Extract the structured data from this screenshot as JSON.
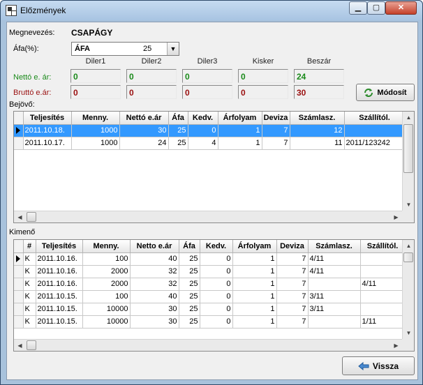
{
  "window": {
    "title": "Előzmények",
    "minimize": "▁",
    "maximize": "▢",
    "close": "✕"
  },
  "form": {
    "name_label": "Megnevezés:",
    "name_value": "CSAPÁGY",
    "afa_label": "Áfa(%):",
    "afa_select_name": "ÁFA",
    "afa_select_value": "25",
    "price_headers": [
      "Diler1",
      "Diler2",
      "Diler3",
      "Kisker",
      "Beszár"
    ],
    "netto_label": "Nettó e. ár:",
    "brutto_label": "Bruttó e.ár:",
    "netto_values": [
      "0",
      "0",
      "0",
      "0",
      "24"
    ],
    "brutto_values": [
      "0",
      "0",
      "0",
      "0",
      "30"
    ],
    "modify_button": "Módosít"
  },
  "incoming": {
    "label": "Bejövő:",
    "columns": [
      "Teljesítés",
      "Menny.",
      "Nettó e.ár",
      "Áfa",
      "Kedv.",
      "Árfolyam",
      "Deviza",
      "Számlasz.",
      "Szállítól."
    ],
    "rows": [
      [
        "2011.10.18.",
        "1000",
        "30",
        "25",
        "0",
        "1",
        "7",
        "12",
        ""
      ],
      [
        "2011.10.17.",
        "1000",
        "24",
        "25",
        "4",
        "1",
        "7",
        "11",
        "2011/123242"
      ]
    ]
  },
  "outgoing": {
    "label": "Kimenő",
    "columns": [
      "#",
      "Teljesítés",
      "Menny.",
      "Netto e.ár",
      "Áfa",
      "Kedv.",
      "Árfolyam",
      "Deviza",
      "Számlasz.",
      "Szállítól."
    ],
    "rows": [
      [
        "K",
        "2011.10.16.",
        "100",
        "40",
        "25",
        "0",
        "1",
        "7",
        "4/11",
        ""
      ],
      [
        "K",
        "2011.10.16.",
        "2000",
        "32",
        "25",
        "0",
        "1",
        "7",
        "4/11",
        ""
      ],
      [
        "K",
        "2011.10.16.",
        "2000",
        "32",
        "25",
        "0",
        "1",
        "7",
        "",
        "4/11"
      ],
      [
        "K",
        "2011.10.15.",
        "100",
        "40",
        "25",
        "0",
        "1",
        "7",
        "3/11",
        ""
      ],
      [
        "K",
        "2011.10.15.",
        "10000",
        "30",
        "25",
        "0",
        "1",
        "7",
        "3/11",
        ""
      ],
      [
        "K",
        "2011.10.15.",
        "10000",
        "30",
        "25",
        "0",
        "1",
        "7",
        "",
        "1/11"
      ]
    ]
  },
  "back_button": "Vissza",
  "colors": {
    "selection": "#3399ff",
    "netto": "#1a8a1a",
    "brutto": "#9a1010"
  },
  "icons": [
    "app-icon",
    "refresh-icon",
    "back-arrow-icon",
    "dropdown-arrow-icon",
    "row-indicator-icon"
  ]
}
